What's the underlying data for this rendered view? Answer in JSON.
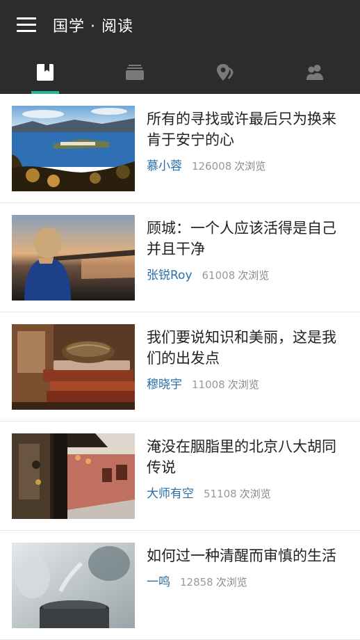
{
  "app": {
    "title": "国学 · 阅读"
  },
  "tabs": [
    {
      "icon": "bookmark-icon",
      "active": true
    },
    {
      "icon": "stack-icon",
      "active": false
    },
    {
      "icon": "map-pin-icon",
      "active": false
    },
    {
      "icon": "people-icon",
      "active": false
    }
  ],
  "colors": {
    "header_bg": "#2c2c2c",
    "accent": "#24b79e",
    "author": "#2a6ea6"
  },
  "articles": [
    {
      "title": "所有的寻找或许最后只为换来肯于安宁的心",
      "author": "慕小蓉",
      "views": "126008",
      "views_unit": "次浏览"
    },
    {
      "title": "顾城：一个人应该活得是自己并且干净",
      "author": "张锐Roy",
      "views": "61008",
      "views_unit": "次浏览"
    },
    {
      "title": "我们要说知识和美丽，这是我们的出发点",
      "author": "穆晓宇",
      "views": "11008",
      "views_unit": "次浏览"
    },
    {
      "title": "淹没在胭脂里的北京八大胡同传说",
      "author": "大师有空",
      "views": "51108",
      "views_unit": "次浏览"
    },
    {
      "title": "如何过一种清醒而审慎的生活",
      "author": "一鸣",
      "views": "12858",
      "views_unit": "次浏览"
    }
  ]
}
